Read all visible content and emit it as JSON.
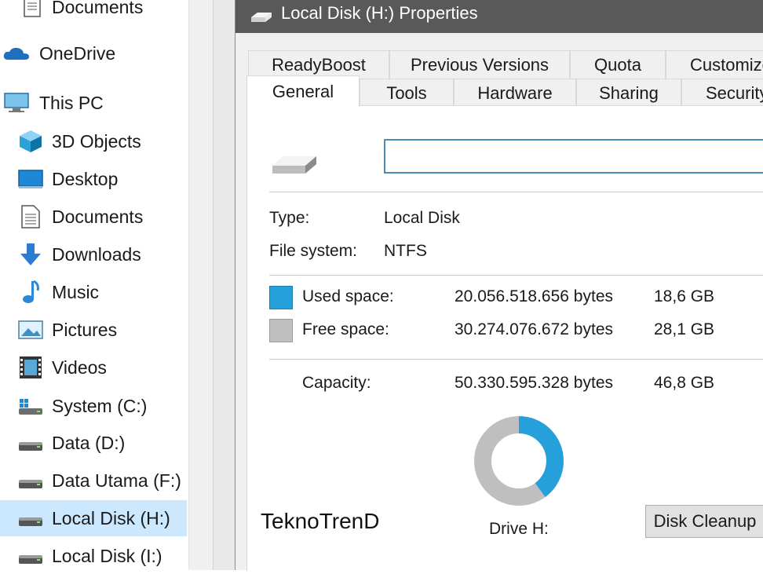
{
  "nav": {
    "items": [
      {
        "label": "Documents",
        "icon": "documents-icon"
      },
      {
        "label": "OneDrive",
        "icon": "onedrive-icon"
      },
      {
        "label": "This PC",
        "icon": "this-pc-icon"
      },
      {
        "label": "3D Objects",
        "icon": "3d-objects-icon"
      },
      {
        "label": "Desktop",
        "icon": "desktop-icon"
      },
      {
        "label": "Documents",
        "icon": "documents-icon"
      },
      {
        "label": "Downloads",
        "icon": "downloads-icon"
      },
      {
        "label": "Music",
        "icon": "music-icon"
      },
      {
        "label": "Pictures",
        "icon": "pictures-icon"
      },
      {
        "label": "Videos",
        "icon": "videos-icon"
      },
      {
        "label": "System (C:)",
        "icon": "system-drive-icon"
      },
      {
        "label": "Data (D:)",
        "icon": "drive-icon"
      },
      {
        "label": "Data Utama (F:)",
        "icon": "drive-icon"
      },
      {
        "label": "Local Disk (H:)",
        "icon": "drive-icon",
        "selected": true
      },
      {
        "label": "Local Disk (I:)",
        "icon": "drive-icon"
      }
    ]
  },
  "dialog": {
    "title": "Local Disk (H:) Properties",
    "tabs_back": [
      "ReadyBoost",
      "Previous Versions",
      "Quota",
      "Customize"
    ],
    "tabs_front": [
      "General",
      "Tools",
      "Hardware",
      "Sharing",
      "Security"
    ],
    "active_tab": "General",
    "name_value": "",
    "type_label": "Type:",
    "type_value": "Local Disk",
    "fs_label": "File system:",
    "fs_value": "NTFS",
    "used_label": "Used space:",
    "used_bytes": "20.056.518.656 bytes",
    "used_gb": "18,6 GB",
    "free_label": "Free space:",
    "free_bytes": "30.274.076.672 bytes",
    "free_gb": "28,1 GB",
    "capacity_label": "Capacity:",
    "capacity_bytes": "50.330.595.328 bytes",
    "capacity_gb": "46,8 GB",
    "drive_label": "Drive H:",
    "disk_cleanup_label": "Disk Cleanup",
    "used_fraction": 0.3985,
    "colors": {
      "used": "#26a0da",
      "free": "#bfbfbf"
    }
  },
  "watermark": "TeknoTrenD"
}
